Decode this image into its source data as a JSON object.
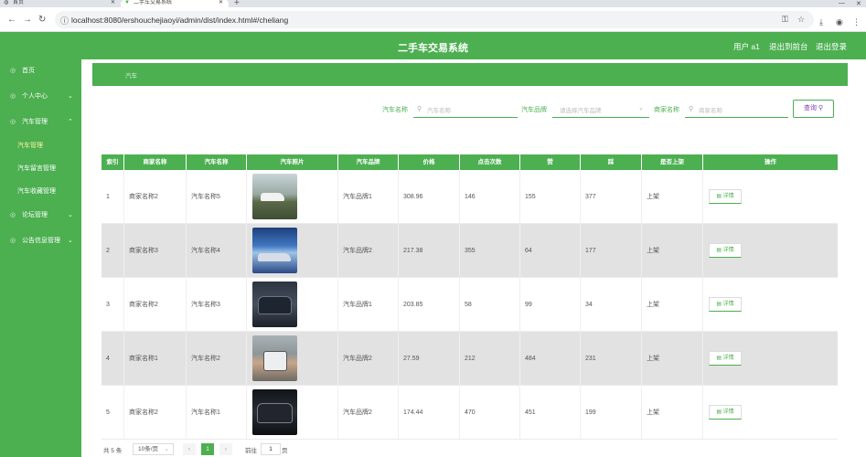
{
  "browser": {
    "tabs": [
      {
        "label": "首页"
      },
      {
        "label": "二手车交易系统"
      }
    ],
    "url": "localhost:8080/ershouchejiaoyi/admin/dist/index.html#/cheliang"
  },
  "header": {
    "title": "二手车交易系统",
    "user": "用户 a1",
    "back_to_front": "退出到前台",
    "logout": "退出登录"
  },
  "sidebar": {
    "items": [
      {
        "label": "首页"
      },
      {
        "label": "个人中心"
      },
      {
        "label": "汽车管理"
      },
      {
        "label": "汽车管理"
      },
      {
        "label": "汽车留言管理"
      },
      {
        "label": "汽车收藏管理"
      },
      {
        "label": "论坛管理"
      },
      {
        "label": "公告信息管理"
      }
    ]
  },
  "breadcrumb": "汽车",
  "search": {
    "name_label": "汽车名称",
    "name_placeholder": "汽车名称",
    "brand_label": "汽车品牌",
    "brand_placeholder": "请选择汽车品牌",
    "merchant_label": "商家名称",
    "merchant_placeholder": "商家名称",
    "query_button": "查询"
  },
  "table": {
    "columns": [
      "索引",
      "商家名称",
      "汽车名称",
      "汽车照片",
      "汽车品牌",
      "价格",
      "点击次数",
      "赞",
      "踩",
      "是否上架",
      "操作"
    ],
    "rows": [
      {
        "index": "1",
        "merchant": "商家名称2",
        "car": "汽车名称5",
        "brand": "汽车品牌1",
        "price": "308.96",
        "clicks": "146",
        "likes": "155",
        "dislikes": "377",
        "status": "上架",
        "action": "详情"
      },
      {
        "index": "2",
        "merchant": "商家名称3",
        "car": "汽车名称4",
        "brand": "汽车品牌2",
        "price": "217.38",
        "clicks": "355",
        "likes": "64",
        "dislikes": "177",
        "status": "上架",
        "action": "详情"
      },
      {
        "index": "3",
        "merchant": "商家名称2",
        "car": "汽车名称3",
        "brand": "汽车品牌1",
        "price": "203.85",
        "clicks": "58",
        "likes": "99",
        "dislikes": "34",
        "status": "上架",
        "action": "详情"
      },
      {
        "index": "4",
        "merchant": "商家名称1",
        "car": "汽车名称2",
        "brand": "汽车品牌2",
        "price": "27.59",
        "clicks": "212",
        "likes": "484",
        "dislikes": "231",
        "status": "上架",
        "action": "详情"
      },
      {
        "index": "5",
        "merchant": "商家名称2",
        "car": "汽车名称1",
        "brand": "汽车品牌2",
        "price": "174.44",
        "clicks": "470",
        "likes": "451",
        "dislikes": "199",
        "status": "上架",
        "action": "详情"
      }
    ]
  },
  "pagination": {
    "total": "共 5 条",
    "page_size": "10条/页",
    "current_page": "1",
    "goto_label": "前往",
    "goto_value": "1",
    "page_suffix": "页"
  },
  "colors": {
    "primary": "#4caf50",
    "row_alt": "#e3e2e3",
    "query_text": "#7b3fb5"
  }
}
